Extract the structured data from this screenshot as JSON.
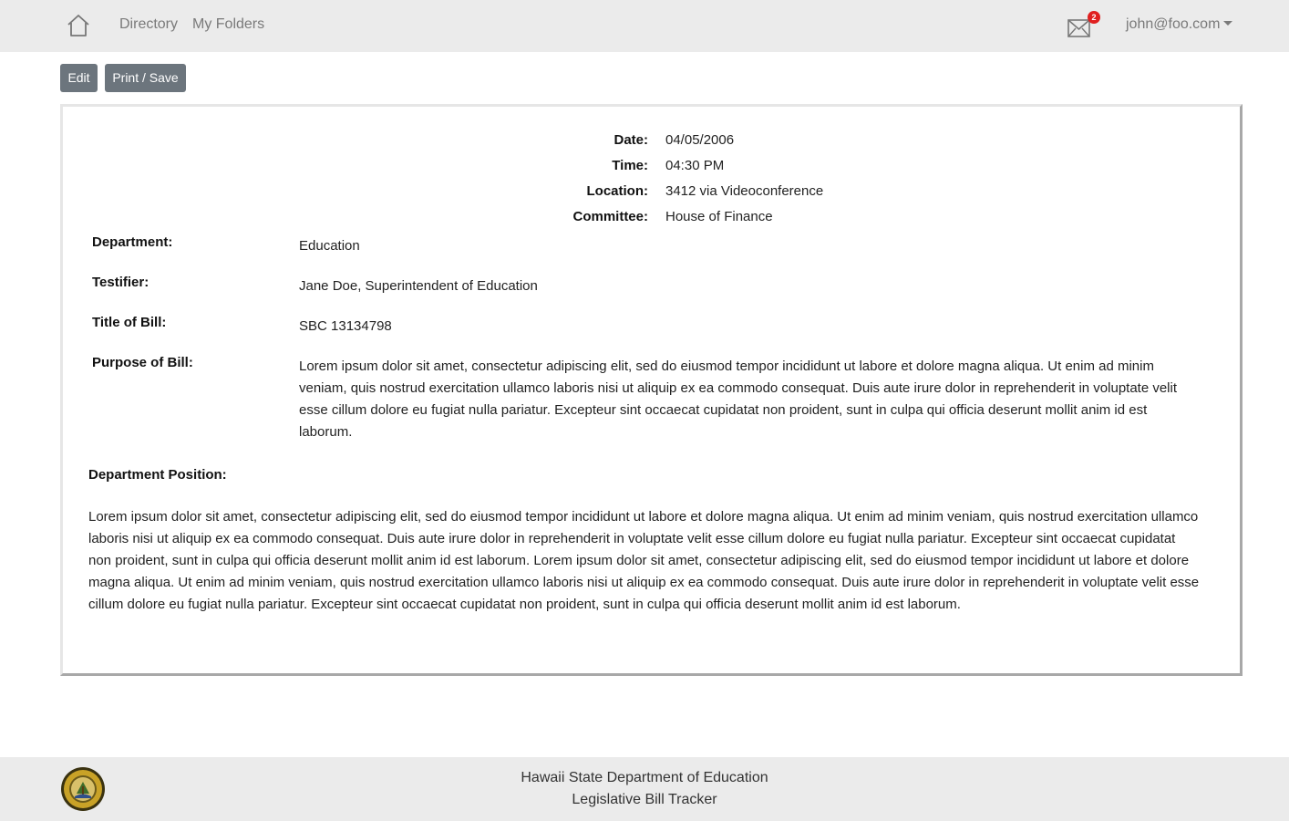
{
  "nav": {
    "home_icon": "home-icon",
    "links": [
      "Directory",
      "My Folders"
    ],
    "mail_icon": "envelope-icon",
    "mail_count": "2",
    "user": "john@foo.com"
  },
  "toolbar": {
    "edit_label": "Edit",
    "print_label": "Print / Save"
  },
  "document": {
    "meta": [
      {
        "label": "Date:",
        "value": "04/05/2006"
      },
      {
        "label": "Time:",
        "value": "04:30 PM"
      },
      {
        "label": "Location:",
        "value": "3412 via Videoconference"
      },
      {
        "label": "Committee:",
        "value": "House of Finance"
      }
    ],
    "fields": [
      {
        "label": "Department:",
        "value": "Education"
      },
      {
        "label": "Testifier:",
        "value": "Jane Doe, Superintendent of Education"
      },
      {
        "label": "Title of Bill:",
        "value": "SBC 13134798"
      },
      {
        "label": "Purpose of Bill:",
        "value": "Lorem ipsum dolor sit amet, consectetur adipiscing elit, sed do eiusmod tempor incididunt ut labore et dolore magna aliqua. Ut enim ad minim veniam, quis nostrud exercitation ullamco laboris nisi ut aliquip ex ea commodo consequat. Duis aute irure dolor in reprehenderit in voluptate velit esse cillum dolore eu fugiat nulla pariatur. Excepteur sint occaecat cupidatat non proident, sunt in culpa qui officia deserunt mollit anim id est laborum."
      }
    ],
    "position_label": "Department Position:",
    "position_text": "Lorem ipsum dolor sit amet, consectetur adipiscing elit, sed do eiusmod tempor incididunt ut labore et dolore magna aliqua. Ut enim ad minim veniam, quis nostrud exercitation ullamco laboris nisi ut aliquip ex ea commodo consequat. Duis aute irure dolor in reprehenderit in voluptate velit esse cillum dolore eu fugiat nulla pariatur. Excepteur sint occaecat cupidatat non proident, sunt in culpa qui officia deserunt mollit anim id est laborum. Lorem ipsum dolor sit amet, consectetur adipiscing elit, sed do eiusmod tempor incididunt ut labore et dolore magna aliqua. Ut enim ad minim veniam, quis nostrud exercitation ullamco laboris nisi ut aliquip ex ea commodo consequat. Duis aute irure dolor in reprehenderit in voluptate velit esse cillum dolore eu fugiat nulla pariatur. Excepteur sint occaecat cupidatat non proident, sunt in culpa qui officia deserunt mollit anim id est laborum."
  },
  "footer": {
    "seal_icon": "state-seal-icon",
    "line1": "Hawaii State Department of Education",
    "line2": "Legislative Bill Tracker"
  }
}
